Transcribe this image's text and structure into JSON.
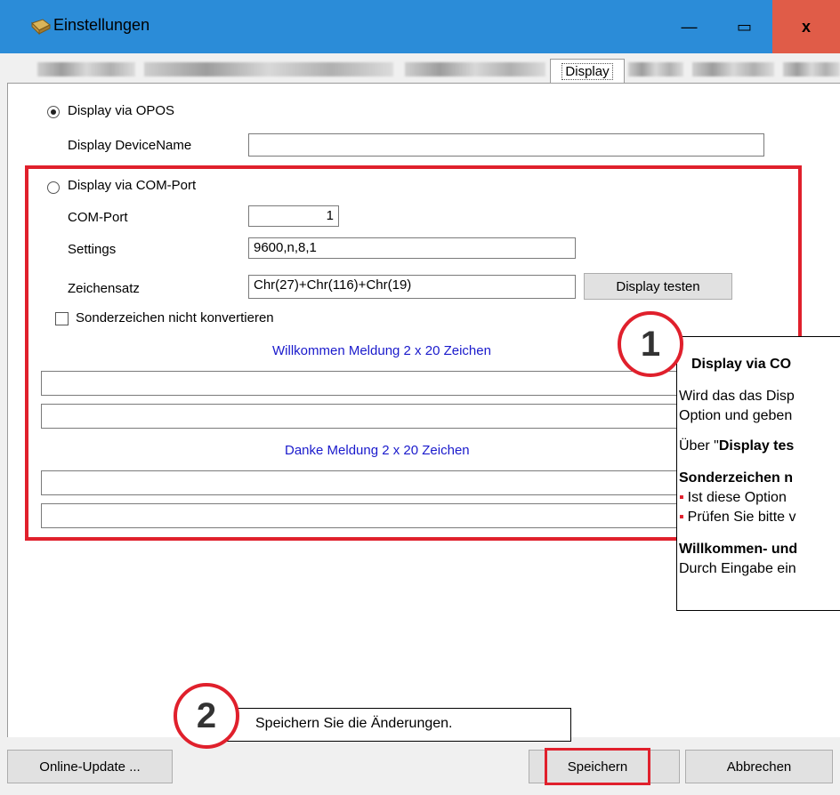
{
  "window": {
    "title": "Einstellungen",
    "min_symbol": "—",
    "max_symbol": "▭",
    "close_symbol": "x"
  },
  "tabs": {
    "active_label": "Display"
  },
  "opos": {
    "radio_label": "Display via OPOS",
    "device_name_label": "Display DeviceName",
    "device_name_value": ""
  },
  "com": {
    "radio_label": "Display via COM-Port",
    "port_label": "COM-Port",
    "port_value": "1",
    "settings_label": "Settings",
    "settings_value": "9600,n,8,1",
    "charset_label": "Zeichensatz",
    "charset_value": "Chr(27)+Chr(116)+Chr(19)",
    "test_button": "Display testen",
    "special_chars_label": "Sonderzeichen nicht konvertieren",
    "welcome_heading": "Willkommen Meldung 2 x 20 Zeichen",
    "thanks_heading": "Danke Meldung 2 x 20 Zeichen"
  },
  "footer": {
    "update_button": "Online-Update ...",
    "save_button": "Speichern",
    "cancel_button": "Abbrechen"
  },
  "callout1": {
    "number": "1",
    "heading": "Display via CO",
    "line1": "Wird das das Disp",
    "line2": "Option und geben",
    "line3_prefix": "Über \"",
    "line3_bold": "Display tes",
    "section_heading": "Sonderzeichen n",
    "bullet1": "Ist diese Option",
    "bullet2": "Prüfen Sie bitte v",
    "section2_heading": "Willkommen- und",
    "section2_text": "Durch Eingabe ein"
  },
  "callout2": {
    "number": "2",
    "text": "Speichern Sie die Änderungen."
  },
  "colors": {
    "titlebar": "#2b8cd8",
    "close": "#e05c48",
    "highlight": "#e0202c",
    "heading_blue": "#1a1acc"
  }
}
